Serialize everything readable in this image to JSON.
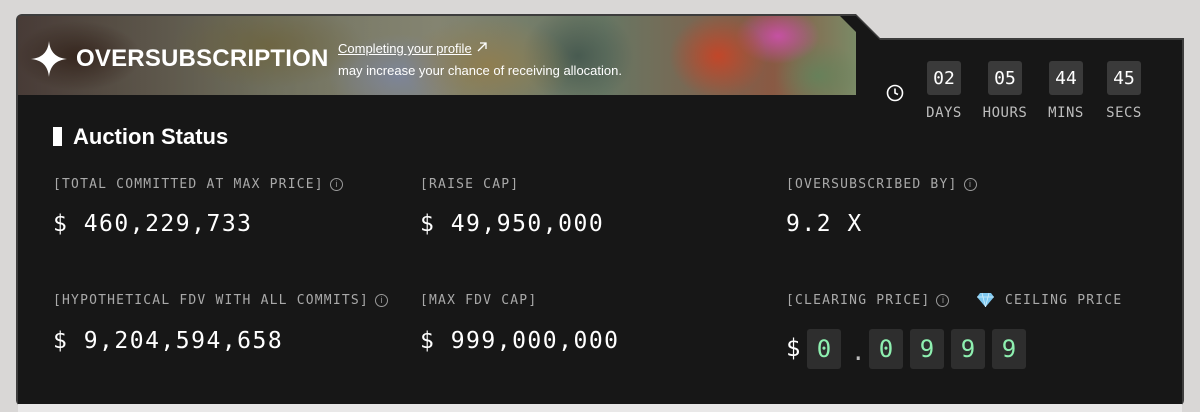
{
  "banner": {
    "title": "OVERSUBSCRIPTION",
    "profile_link": "Completing your profile",
    "subtitle": "may increase your chance of receiving allocation.",
    "icons": {
      "star": "sparkle-star-icon",
      "link": "arrow-up-right-icon"
    }
  },
  "countdown": {
    "icon": "clock-icon",
    "days": {
      "value": "02",
      "label": "DAYS"
    },
    "hours": {
      "value": "05",
      "label": "HOURS"
    },
    "mins": {
      "value": "44",
      "label": "MINS"
    },
    "secs": {
      "value": "45",
      "label": "SECS"
    }
  },
  "auction": {
    "title": "Auction Status",
    "total_committed": {
      "label": "[TOTAL COMMITTED AT MAX PRICE]",
      "value": "$ 460,229,733"
    },
    "raise_cap": {
      "label": "[RAISE CAP]",
      "value": "$ 49,950,000"
    },
    "oversubscribed": {
      "label": "[OVERSUBSCRIBED BY]",
      "value": "9.2 X"
    },
    "hypothetical_fdv": {
      "label": "[HYPOTHETICAL FDV WITH ALL COMMITS]",
      "value": "$ 9,204,594,658"
    },
    "max_fdv_cap": {
      "label": "[MAX FDV CAP]",
      "value": "$ 999,000,000"
    },
    "clearing_price": {
      "label": "[CLEARING PRICE]",
      "ceiling_label": "CEILING PRICE",
      "currency": "$",
      "separator": ".",
      "digits": [
        "0",
        "0",
        "9",
        "9",
        "9"
      ]
    }
  },
  "colors": {
    "background": "#d9d7d6",
    "card": "#171717",
    "accent_green": "#8ef0b0",
    "label_gray": "#a9a9a9",
    "gem": "#7ec8f0"
  }
}
